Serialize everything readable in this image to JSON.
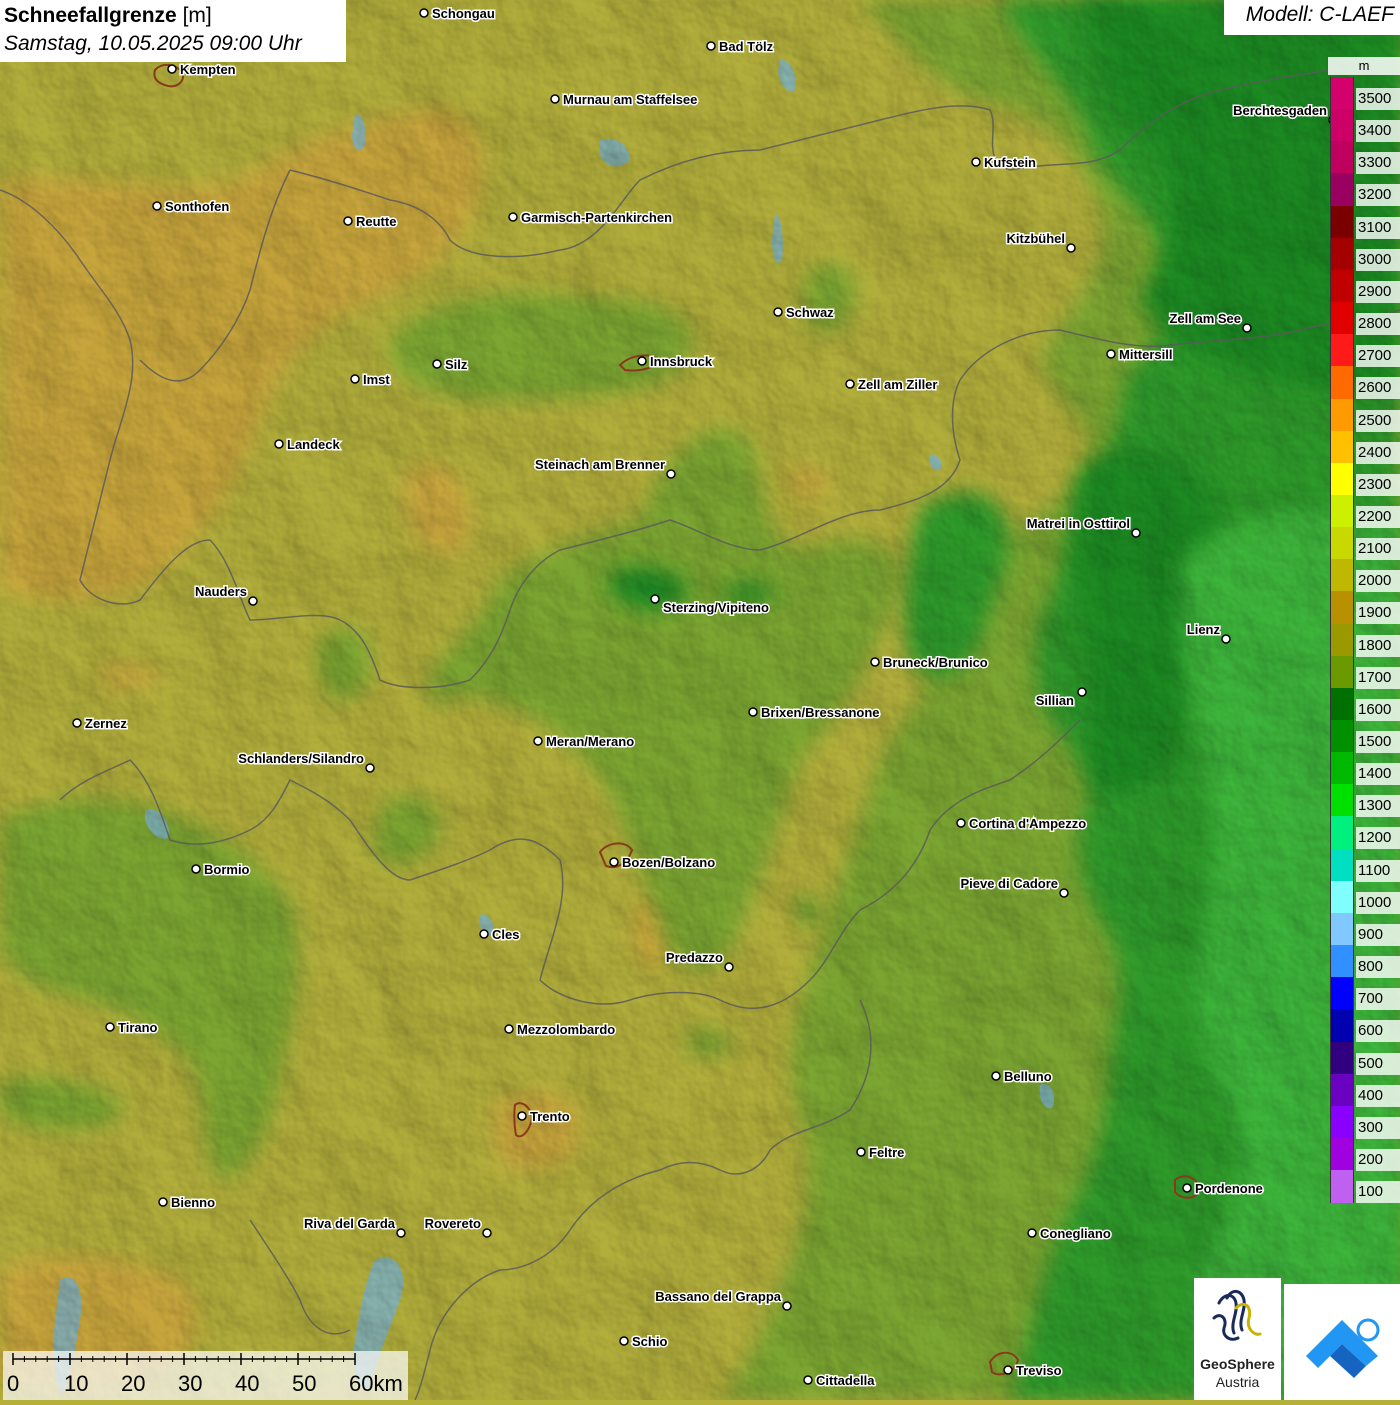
{
  "header": {
    "title_bold": "Schneefallgrenze",
    "title_unit": "[m]",
    "datetime": "Samstag, 10.05.2025 09:00 Uhr",
    "model": "Modell: C-LAEF"
  },
  "legend": {
    "unit": "m",
    "levels": [
      {
        "value": "3500",
        "color": "#d4006c"
      },
      {
        "value": "3400",
        "color": "#cc0066"
      },
      {
        "value": "3300",
        "color": "#c0005e"
      },
      {
        "value": "3200",
        "color": "#9a0060"
      },
      {
        "value": "3100",
        "color": "#7a0000"
      },
      {
        "value": "3000",
        "color": "#a50000"
      },
      {
        "value": "2900",
        "color": "#c00000"
      },
      {
        "value": "2800",
        "color": "#e00000"
      },
      {
        "value": "2700",
        "color": "#ff1a1a"
      },
      {
        "value": "2600",
        "color": "#ff6a00"
      },
      {
        "value": "2500",
        "color": "#ff9a00"
      },
      {
        "value": "2400",
        "color": "#ffc000"
      },
      {
        "value": "2300",
        "color": "#ffff00"
      },
      {
        "value": "2200",
        "color": "#ccf000"
      },
      {
        "value": "2100",
        "color": "#c8d800"
      },
      {
        "value": "2000",
        "color": "#c0b800"
      },
      {
        "value": "1900",
        "color": "#b89000"
      },
      {
        "value": "1800",
        "color": "#9a9a00"
      },
      {
        "value": "1700",
        "color": "#6a9a00"
      },
      {
        "value": "1600",
        "color": "#007000"
      },
      {
        "value": "1500",
        "color": "#009000"
      },
      {
        "value": "1400",
        "color": "#00b800"
      },
      {
        "value": "1300",
        "color": "#00e000"
      },
      {
        "value": "1200",
        "color": "#00f080"
      },
      {
        "value": "1100",
        "color": "#00e0c0"
      },
      {
        "value": "1000",
        "color": "#80ffff"
      },
      {
        "value": "900",
        "color": "#80c8ff"
      },
      {
        "value": "800",
        "color": "#3090ff"
      },
      {
        "value": "700",
        "color": "#0000ff"
      },
      {
        "value": "600",
        "color": "#0000b0"
      },
      {
        "value": "500",
        "color": "#300080"
      },
      {
        "value": "400",
        "color": "#6a00c0"
      },
      {
        "value": "300",
        "color": "#8a00ff"
      },
      {
        "value": "200",
        "color": "#a000e0"
      },
      {
        "value": "100",
        "color": "#c060f0"
      }
    ]
  },
  "cities": [
    {
      "name": "Schongau"
    },
    {
      "name": "Kempten"
    },
    {
      "name": "Bad Tölz"
    },
    {
      "name": "Murnau am Staffelsee"
    },
    {
      "name": "Berchtesgaden"
    },
    {
      "name": "Kufstein"
    },
    {
      "name": "Sonthofen"
    },
    {
      "name": "Reutte"
    },
    {
      "name": "Garmisch-Partenkirchen"
    },
    {
      "name": "Kitzbühel"
    },
    {
      "name": "Schwaz"
    },
    {
      "name": "Zell am See"
    },
    {
      "name": "Innsbruck"
    },
    {
      "name": "Silz"
    },
    {
      "name": "Imst"
    },
    {
      "name": "Mittersill"
    },
    {
      "name": "Zell am Ziller"
    },
    {
      "name": "Landeck"
    },
    {
      "name": "Steinach am Brenner"
    },
    {
      "name": "Matrei in Osttirol"
    },
    {
      "name": "Nauders"
    },
    {
      "name": "Sterzing/Vipiteno"
    },
    {
      "name": "Lienz"
    },
    {
      "name": "Bruneck/Brunico"
    },
    {
      "name": "Sillian"
    },
    {
      "name": "Zernez"
    },
    {
      "name": "Brixen/Bressanone"
    },
    {
      "name": "Meran/Merano"
    },
    {
      "name": "Schlanders/Silandro"
    },
    {
      "name": "Cortina d'Ampezzo"
    },
    {
      "name": "Bormio"
    },
    {
      "name": "Bozen/Bolzano"
    },
    {
      "name": "Pieve di Cadore"
    },
    {
      "name": "Cles"
    },
    {
      "name": "Predazzo"
    },
    {
      "name": "Tirano"
    },
    {
      "name": "Mezzolombardo"
    },
    {
      "name": "Belluno"
    },
    {
      "name": "Trento"
    },
    {
      "name": "Feltre"
    },
    {
      "name": "Pordenone"
    },
    {
      "name": "Bienno"
    },
    {
      "name": "Riva del Garda"
    },
    {
      "name": "Rovereto"
    },
    {
      "name": "Conegliano"
    },
    {
      "name": "Bassano del Grappa"
    },
    {
      "name": "Schio"
    },
    {
      "name": "Treviso"
    },
    {
      "name": "Cittadella"
    }
  ],
  "scalebar": {
    "labels": [
      "0",
      "10",
      "20",
      "30",
      "40",
      "50",
      "60km"
    ]
  },
  "logos": {
    "geosphere_line1": "GeoSphere",
    "geosphere_line2": "Austria"
  }
}
